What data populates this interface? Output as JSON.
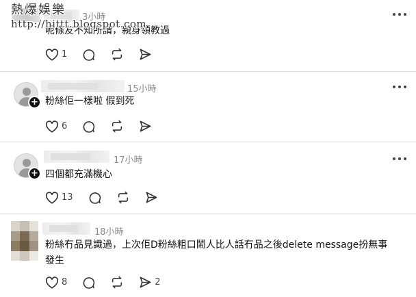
{
  "watermark": {
    "title": "熱爆娛樂",
    "url": "http://hittt.blogspot.com"
  },
  "posts": [
    {
      "time": "3小時",
      "text": "呢條友不知所謂，親身領教過",
      "likes": "1",
      "reposts": ""
    },
    {
      "time": "15小時",
      "text": "粉絲佢一樣啦 假到死",
      "likes": "6",
      "reposts": ""
    },
    {
      "time": "17小時",
      "text": "四個都充滿機心",
      "likes": "13",
      "reposts": ""
    },
    {
      "time": "18小時",
      "text_line1": "粉絲冇品見識過，上次佢D粉絲粗口鬧人比人話冇品之後delete message扮無事",
      "text_line2": "發生",
      "likes": "8",
      "reposts": "2"
    }
  ],
  "icons": {
    "like": "heart-icon",
    "reply": "comment-icon",
    "repost": "repost-icon",
    "share": "send-icon",
    "more": "more-icon",
    "follow": "plus-icon"
  },
  "colors": {
    "text": "#111111",
    "muted": "#8a8a8a",
    "divider": "#d9d9d9",
    "icon": "#444444"
  }
}
